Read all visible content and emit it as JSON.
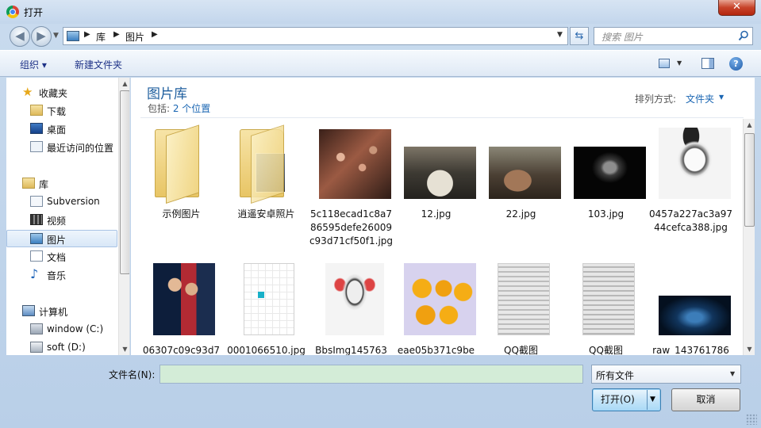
{
  "window": {
    "title": "打开"
  },
  "address": {
    "crumbs": [
      "库",
      "图片"
    ]
  },
  "search": {
    "placeholder": "搜索 图片"
  },
  "toolbar": {
    "organize": "组织 ▾",
    "new_folder": "新建文件夹"
  },
  "sidebar": {
    "favorites": {
      "label": "收藏夹",
      "items": [
        "下载",
        "桌面",
        "最近访问的位置"
      ]
    },
    "libraries": {
      "label": "库",
      "items": [
        "Subversion",
        "视频",
        "图片",
        "文档",
        "音乐"
      ]
    },
    "computer": {
      "label": "计算机",
      "items": [
        "window (C:)",
        "soft (D:)"
      ]
    },
    "selected": "图片"
  },
  "library": {
    "title": "图片库",
    "includes_prefix": "包括: ",
    "includes_link": "2 个位置",
    "arrange_label": "排列方式:",
    "arrange_value": "文件夹"
  },
  "files": [
    {
      "name": "示例图片",
      "kind": "folder"
    },
    {
      "name": "逍遥安卓照片",
      "kind": "folder"
    },
    {
      "name": "5c118ecad1c8a786595defe26009c93d71cf50f1.jpg",
      "kind": "image"
    },
    {
      "name": "12.jpg",
      "kind": "image"
    },
    {
      "name": "22.jpg",
      "kind": "image"
    },
    {
      "name": "103.jpg",
      "kind": "image"
    },
    {
      "name": "0457a227ac3a9744cefca388.jpg",
      "kind": "image"
    },
    {
      "name": "06307c09c93d7",
      "kind": "image"
    },
    {
      "name": "0001066510.jpg",
      "kind": "image"
    },
    {
      "name": "BbsImg145763",
      "kind": "image"
    },
    {
      "name": "eae05b371c9be",
      "kind": "image"
    },
    {
      "name": "QQ截图",
      "kind": "image"
    },
    {
      "name": "QQ截图",
      "kind": "image"
    },
    {
      "name": "raw_143761786",
      "kind": "image"
    }
  ],
  "bottom": {
    "filename_label": "文件名(N):",
    "filename_value": "",
    "filetype_value": "所有文件",
    "open_label": "打开(O)",
    "cancel_label": "取消"
  }
}
